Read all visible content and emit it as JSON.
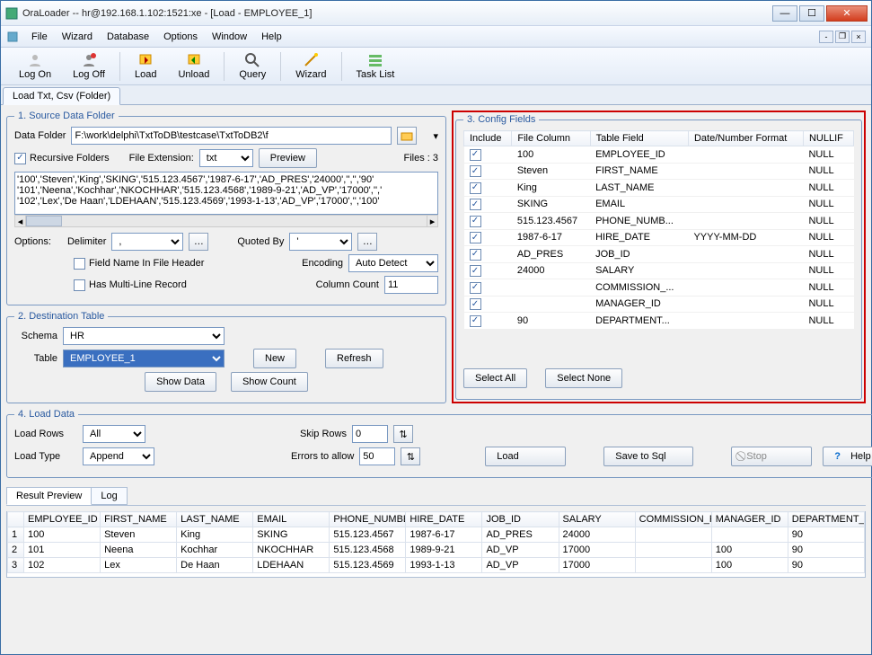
{
  "window": {
    "title": "OraLoader -- hr@192.168.1.102:1521:xe - [Load - EMPLOYEE_1]"
  },
  "menus": [
    "File",
    "Wizard",
    "Database",
    "Options",
    "Window",
    "Help"
  ],
  "toolbar": [
    {
      "id": "logon",
      "label": "Log On"
    },
    {
      "id": "logoff",
      "label": "Log Off"
    },
    {
      "id": "load",
      "label": "Load"
    },
    {
      "id": "unload",
      "label": "Unload"
    },
    {
      "id": "query",
      "label": "Query"
    },
    {
      "id": "wizard",
      "label": "Wizard"
    },
    {
      "id": "tasklist",
      "label": "Task List"
    }
  ],
  "main_tab": "Load Txt, Csv (Folder)",
  "panel1": {
    "title": "1. Source Data Folder",
    "data_folder_label": "Data Folder",
    "data_folder_value": "F:\\work\\delphi\\TxtToDB\\testcase\\TxtToDB2\\f",
    "recursive_label": "Recursive Folders",
    "file_ext_label": "File Extension:",
    "file_ext_value": "txt",
    "preview_btn": "Preview",
    "files_label": "Files : 3",
    "sample_text": "'100','Steven','King','SKING','515.123.4567','1987-6-17','AD_PRES','24000','','','90'\n'101','Neena','Kochhar','NKOCHHAR','515.123.4568','1989-9-21','AD_VP','17000','','\n'102','Lex','De Haan','LDEHAAN','515.123.4569','1993-1-13','AD_VP','17000','','100'",
    "options_label": "Options:",
    "delimiter_label": "Delimiter",
    "quoted_by_label": "Quoted By",
    "field_header_label": "Field Name In File Header",
    "encoding_label": "Encoding",
    "encoding_value": "Auto Detect",
    "multiline_label": "Has Multi-Line Record",
    "colcount_label": "Column Count",
    "colcount_value": "11"
  },
  "panel2": {
    "title": "2. Destination Table",
    "schema_label": "Schema",
    "schema_value": "HR",
    "table_label": "Table",
    "table_value": "EMPLOYEE_1",
    "new_btn": "New",
    "refresh_btn": "Refresh",
    "show_data_btn": "Show Data",
    "show_count_btn": "Show Count"
  },
  "panel3": {
    "title": "3. Config Fields",
    "headers": [
      "Include",
      "File Column",
      "Table Field",
      "Date/Number Format",
      "NULLIF"
    ],
    "rows": [
      {
        "file": "100",
        "field": "EMPLOYEE_ID",
        "fmt": "",
        "nullif": "NULL"
      },
      {
        "file": "Steven",
        "field": "FIRST_NAME",
        "fmt": "",
        "nullif": "NULL"
      },
      {
        "file": "King",
        "field": "LAST_NAME",
        "fmt": "",
        "nullif": "NULL"
      },
      {
        "file": "SKING",
        "field": "EMAIL",
        "fmt": "",
        "nullif": "NULL"
      },
      {
        "file": "515.123.4567",
        "field": "PHONE_NUMB...",
        "fmt": "",
        "nullif": "NULL"
      },
      {
        "file": "1987-6-17",
        "field": "HIRE_DATE",
        "fmt": "YYYY-MM-DD",
        "nullif": "NULL"
      },
      {
        "file": "AD_PRES",
        "field": "JOB_ID",
        "fmt": "",
        "nullif": "NULL"
      },
      {
        "file": "24000",
        "field": "SALARY",
        "fmt": "",
        "nullif": "NULL"
      },
      {
        "file": "",
        "field": "COMMISSION_...",
        "fmt": "",
        "nullif": "NULL"
      },
      {
        "file": "",
        "field": "MANAGER_ID",
        "fmt": "",
        "nullif": "NULL"
      },
      {
        "file": "90",
        "field": "DEPARTMENT...",
        "fmt": "",
        "nullif": "NULL"
      }
    ],
    "select_all": "Select All",
    "select_none": "Select None"
  },
  "panel4": {
    "title": "4. Load Data",
    "load_rows_label": "Load Rows",
    "load_rows_value": "All",
    "skip_rows_label": "Skip Rows",
    "skip_rows_value": "0",
    "load_type_label": "Load Type",
    "load_type_value": "Append",
    "errors_label": "Errors to allow",
    "errors_value": "50",
    "load_btn": "Load",
    "save_sql_btn": "Save to Sql",
    "stop_btn": "Stop",
    "help_btn": "Help"
  },
  "results": {
    "tab1": "Result Preview",
    "tab2": "Log",
    "headers": [
      "",
      "EMPLOYEE_ID",
      "FIRST_NAME",
      "LAST_NAME",
      "EMAIL",
      "PHONE_NUMBER",
      "HIRE_DATE",
      "JOB_ID",
      "SALARY",
      "COMMISSION_PCT",
      "MANAGER_ID",
      "DEPARTMENT_II"
    ],
    "rows": [
      [
        "1",
        "100",
        "Steven",
        "King",
        "SKING",
        "515.123.4567",
        "1987-6-17",
        "AD_PRES",
        "24000",
        "",
        "",
        "90"
      ],
      [
        "2",
        "101",
        "Neena",
        "Kochhar",
        "NKOCHHAR",
        "515.123.4568",
        "1989-9-21",
        "AD_VP",
        "17000",
        "",
        "100",
        "90"
      ],
      [
        "3",
        "102",
        "Lex",
        "De Haan",
        "LDEHAAN",
        "515.123.4569",
        "1993-1-13",
        "AD_VP",
        "17000",
        "",
        "100",
        "90"
      ]
    ]
  }
}
